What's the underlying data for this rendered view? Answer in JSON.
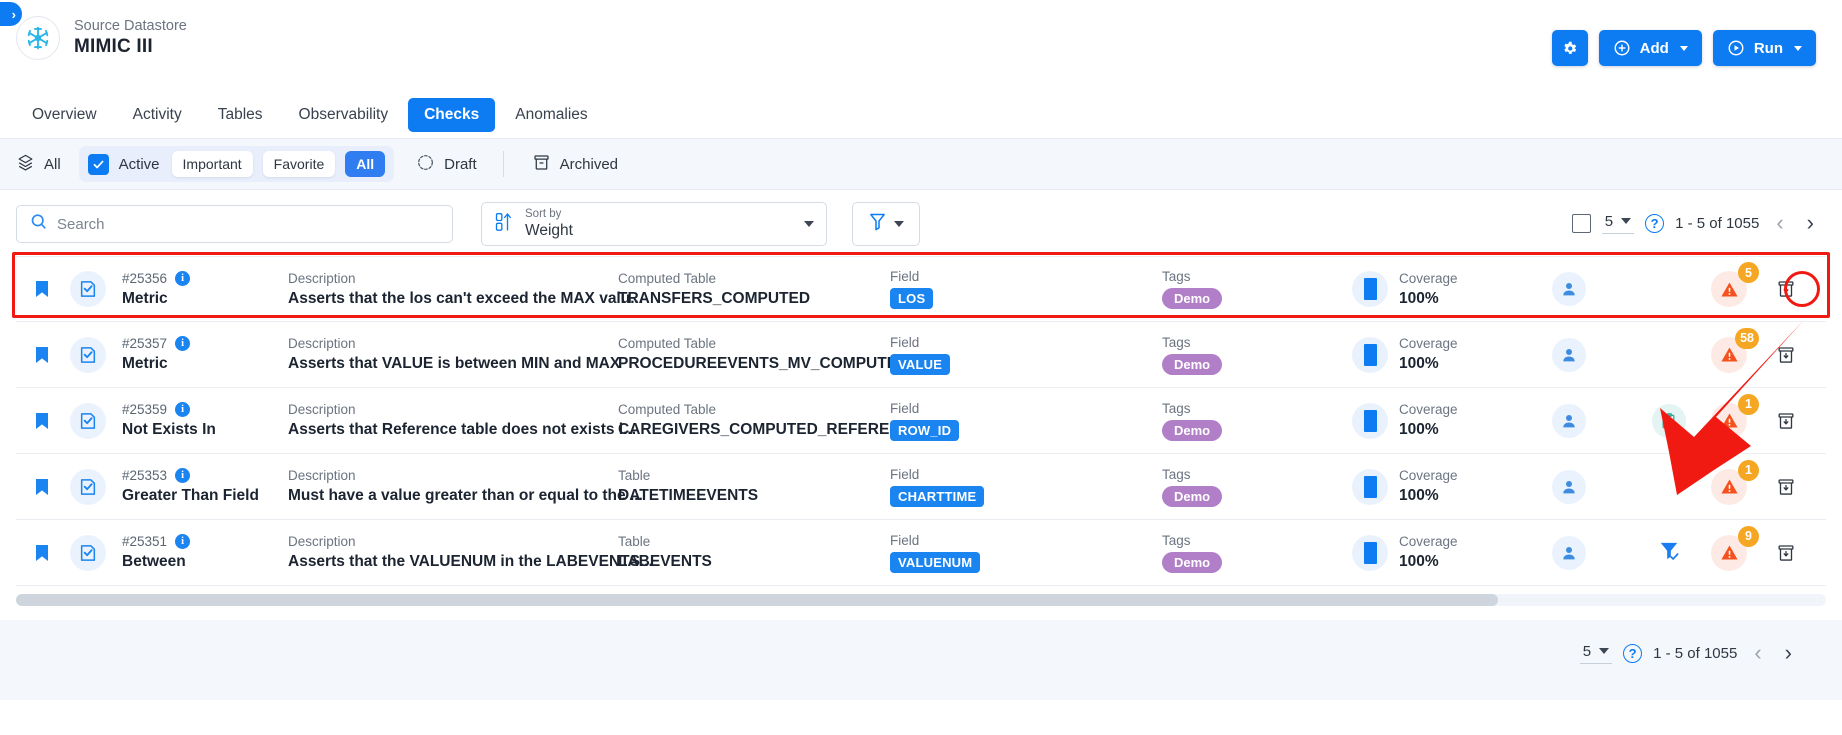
{
  "window": {
    "collapse_toggle": "›"
  },
  "header": {
    "datastore_label": "Source Datastore",
    "datastore_name": "MIMIC III",
    "logo_icon": "snowflake-icon",
    "actions": {
      "settings_icon": "gear-icon",
      "add_label": "Add",
      "add_icon": "plus-circle-icon",
      "run_label": "Run",
      "run_icon": "play-circle-icon"
    }
  },
  "tabs": [
    {
      "label": "Overview",
      "active": false
    },
    {
      "label": "Activity",
      "active": false
    },
    {
      "label": "Tables",
      "active": false
    },
    {
      "label": "Observability",
      "active": false
    },
    {
      "label": "Checks",
      "active": true
    },
    {
      "label": "Anomalies",
      "active": false
    }
  ],
  "filter_bar": {
    "all_icon": "layers-icon",
    "all_label": "All",
    "active_label": "Active",
    "active_checked": true,
    "chips": [
      {
        "label": "Important",
        "active": false
      },
      {
        "label": "Favorite",
        "active": false
      },
      {
        "label": "All",
        "active": true
      }
    ],
    "draft_icon": "draft-check-icon",
    "draft_label": "Draft",
    "archived_icon": "archive-icon",
    "archived_label": "Archived"
  },
  "toolbar": {
    "search_placeholder": "Search",
    "search_value": "",
    "search_icon": "search-icon",
    "sort_icon": "sort-numeric-icon",
    "sort_label": "Sort by",
    "sort_value": "Weight",
    "filter_icon": "funnel-icon"
  },
  "pagination": {
    "select_all_checkbox": "",
    "page_size": "5",
    "help_icon": "?",
    "range": "1 - 5 of 1055",
    "prev_icon": "‹",
    "next_icon": "›"
  },
  "table": {
    "labels": {
      "description": "Description",
      "computed_table": "Computed Table",
      "table": "Table",
      "field": "Field",
      "tags": "Tags",
      "coverage": "Coverage"
    },
    "rows": [
      {
        "id": "#25356",
        "type": "Metric",
        "description": "Asserts that the los can't exceed the MAX valu...",
        "table_label": "Computed Table",
        "table_name": "TRANSFERS_COMPUTED",
        "field": "LOS",
        "tag": "Demo",
        "coverage": "100%",
        "alert_count": "5",
        "has_clipboard": false,
        "has_filter": false,
        "highlighted": true
      },
      {
        "id": "#25357",
        "type": "Metric",
        "description": "Asserts that VALUE is between MIN and MAX",
        "table_label": "Computed Table",
        "table_name": "PROCEDUREEVENTS_MV_COMPUTED",
        "field": "VALUE",
        "tag": "Demo",
        "coverage": "100%",
        "alert_count": "58",
        "has_clipboard": false,
        "has_filter": false,
        "highlighted": false
      },
      {
        "id": "#25359",
        "type": "Not Exists In",
        "description": "Asserts that Reference table does not exists i...",
        "table_label": "Computed Table",
        "table_name": "CAREGIVERS_COMPUTED_REFERENCE",
        "field": "ROW_ID",
        "tag": "Demo",
        "coverage": "100%",
        "alert_count": "1",
        "has_clipboard": true,
        "has_filter": false,
        "highlighted": false
      },
      {
        "id": "#25353",
        "type": "Greater Than Field",
        "description": "Must have a value greater than or equal to the ...",
        "table_label": "Table",
        "table_name": "DATETIMEEVENTS",
        "field": "CHARTTIME",
        "tag": "Demo",
        "coverage": "100%",
        "alert_count": "1",
        "has_clipboard": false,
        "has_filter": false,
        "highlighted": false
      },
      {
        "id": "#25351",
        "type": "Between",
        "description": "Asserts that the VALUENUM in the LABEVENTS...",
        "table_label": "Table",
        "table_name": "LABEVENTS",
        "field": "VALUENUM",
        "tag": "Demo",
        "coverage": "100%",
        "alert_count": "9",
        "has_clipboard": false,
        "has_filter": true,
        "highlighted": false
      }
    ]
  },
  "bottom_pagination": {
    "page_size": "5",
    "help_icon": "?",
    "range": "1 - 5 of 1055",
    "prev_icon": "‹",
    "next_icon": "›"
  },
  "colors": {
    "accent": "#0d7cf2",
    "tag": "#b07fc7",
    "badge": "#f5a623",
    "alert": "#f4511e",
    "highlight": "#f01a12"
  }
}
